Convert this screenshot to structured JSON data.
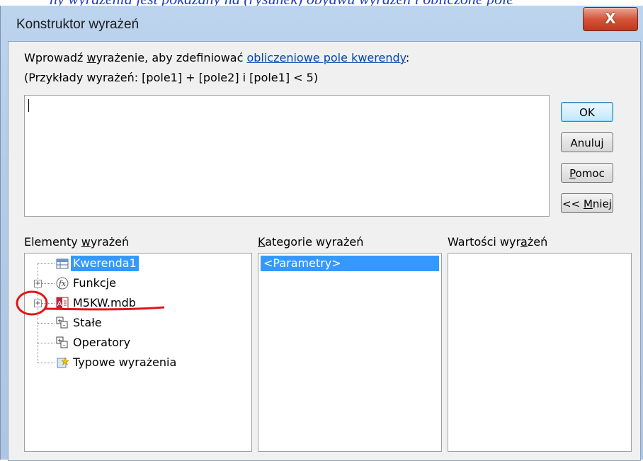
{
  "background_text": "ny wyrażenia jest pokazany na (rysunek) obydwu wyrażeń i obliczone pole",
  "window": {
    "title": "Konstruktor wyrażeń",
    "close_glyph": "X"
  },
  "instruction": {
    "prefix": "Wprowadź ",
    "underlined": "w",
    "middle": "yrażenie, aby zdefiniować ",
    "link": "obliczeniowe pole kwerendy",
    "suffix": ":"
  },
  "example": "(Przykłady wyrażeń: [pole1] + [pole2] i [pole1] < 5)",
  "expression_value": "",
  "buttons": {
    "ok": "OK",
    "cancel": "Anuluj",
    "help_access": "P",
    "help_rest": "omoc",
    "less_prefix": "<< ",
    "less_access": "M",
    "less_rest": "niej"
  },
  "elements": {
    "label_pre": "Elementy ",
    "label_access": "w",
    "label_post": "yrażeń",
    "items": [
      {
        "label": "Kwerenda1",
        "icon": "query-icon",
        "selected": true,
        "expandable": false
      },
      {
        "label": "Funkcje",
        "icon": "function-icon",
        "selected": false,
        "expandable": true
      },
      {
        "label": "M5KW.mdb",
        "icon": "database-icon",
        "selected": false,
        "expandable": true
      },
      {
        "label": "Stałe",
        "icon": "constants-icon",
        "selected": false,
        "expandable": false
      },
      {
        "label": "Operatory",
        "icon": "operators-icon",
        "selected": false,
        "expandable": false
      },
      {
        "label": "Typowe wyrażenia",
        "icon": "common-expressions-icon",
        "selected": false,
        "expandable": false
      }
    ]
  },
  "categories": {
    "label_access": "K",
    "label_rest": "ategorie wyrażeń",
    "items": [
      "<Parametry>"
    ]
  },
  "values": {
    "label_pre": "Wartości wyr",
    "label_access": "a",
    "label_post": "żeń",
    "items": []
  },
  "colors": {
    "selection": "#3399ff",
    "annotation": "#e0161b",
    "link": "#0645ad",
    "close_button": "#c9442a"
  }
}
